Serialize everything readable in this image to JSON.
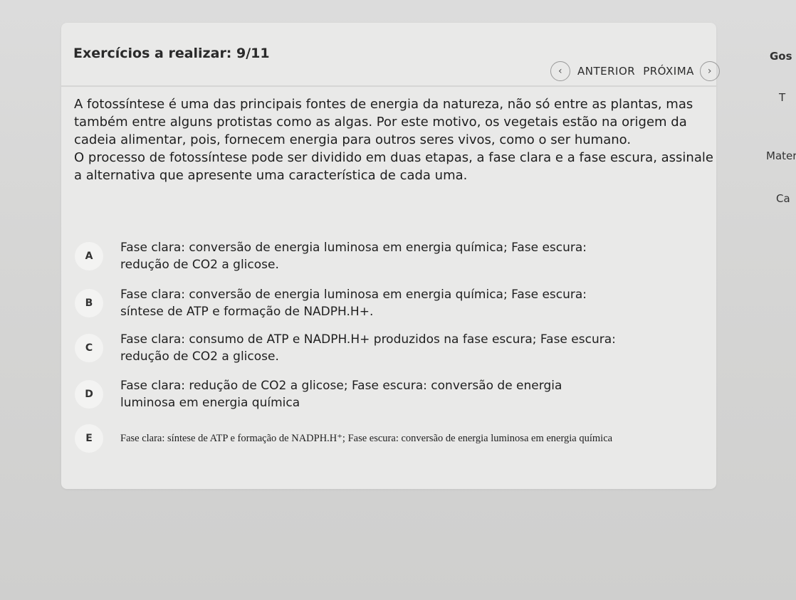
{
  "header": {
    "title": "Exercícios a realizar: 9/11",
    "prev_label": "ANTERIOR",
    "next_label": "PRÓXIMA"
  },
  "question": {
    "paragraph1": "A fotossíntese é uma das principais fontes de energia da natureza, não só entre as plantas, mas também entre alguns protistas como as algas. Por este motivo, os vegetais estão na origem da cadeia alimentar, pois, fornecem energia para outros seres vivos, como o ser humano.",
    "paragraph2": "O processo de fotossíntese pode ser dividido em duas etapas, a fase clara e a fase escura, assinale a alternativa que apresente uma característica de cada uma."
  },
  "options": [
    {
      "letter": "A",
      "text": "Fase clara: conversão de energia luminosa em energia química; Fase escura: redução de CO2 a glicose."
    },
    {
      "letter": "B",
      "text": "Fase clara: conversão de energia luminosa em energia química; Fase escura: síntese de ATP e formação de NADPH.H+."
    },
    {
      "letter": "C",
      "text": "Fase clara: consumo de ATP e NADPH.H+ produzidos na fase escura; Fase escura: redução de CO2 a glicose."
    },
    {
      "letter": "D",
      "text": "Fase clara: redução de CO2 a glicose; Fase escura: conversão de energia luminosa em energia química"
    },
    {
      "letter": "E",
      "text": "Fase clara: síntese de ATP e formação de NADPH.H⁺; Fase escura: conversão de energia luminosa em energia química"
    }
  ],
  "right_panel": {
    "item1": "Gos",
    "item2": "T",
    "item3": "Mater",
    "item4": "Ca"
  }
}
